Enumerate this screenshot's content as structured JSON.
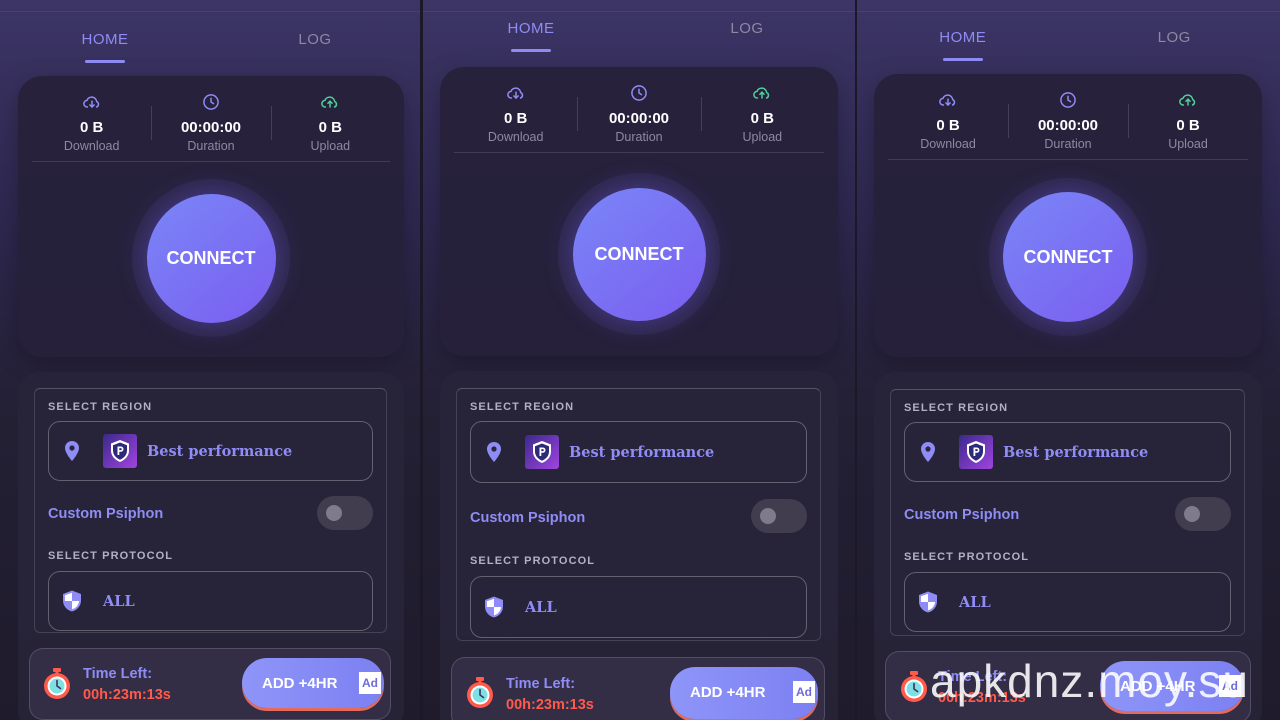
{
  "tabs": {
    "home": "HOME",
    "log": "LOG"
  },
  "stats": {
    "download": {
      "value": "0 B",
      "label": "Download"
    },
    "duration": {
      "value": "00:00:00",
      "label": "Duration"
    },
    "upload": {
      "value": "0 B",
      "label": "Upload"
    }
  },
  "connect_label": "CONNECT",
  "region": {
    "section": "SELECT REGION",
    "value": "Best performance"
  },
  "custom": {
    "label": "Custom Psiphon",
    "enabled": false
  },
  "protocol": {
    "section": "SELECT PROTOCOL",
    "value": "ALL"
  },
  "timer": {
    "label": "Time Left:",
    "value": "00h:23m:13s"
  },
  "add_button": {
    "label": "ADD +4HR",
    "badge": "Ad"
  },
  "watermark": "apkdnz.moy.su",
  "colors": {
    "accent": "#8f8cf5",
    "timer": "#ff5a4a",
    "download_icon": "#8f8cf5",
    "upload_icon": "#4fd09a"
  },
  "icons": [
    "cloud-download-icon",
    "clock-icon",
    "cloud-upload-icon",
    "location-pin-icon",
    "psiphon-shield-logo",
    "shield-icon",
    "stopwatch-icon"
  ]
}
